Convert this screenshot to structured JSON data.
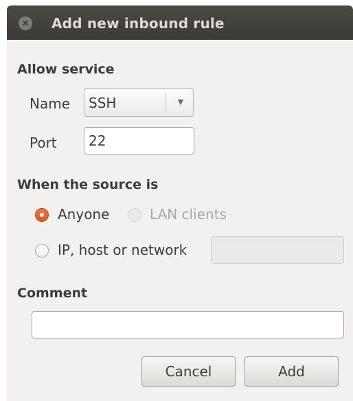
{
  "dialog": {
    "title": "Add new inbound rule",
    "close_icon": "×"
  },
  "allow_service": {
    "heading": "Allow service",
    "name_label": "Name",
    "name_value": "SSH",
    "dropdown_icon": "▼",
    "port_label": "Port",
    "port_value": "22"
  },
  "source": {
    "heading": "When the source is",
    "options": [
      {
        "label": "Anyone",
        "checked": true,
        "enabled": true
      },
      {
        "label": "LAN clients",
        "checked": false,
        "enabled": false
      },
      {
        "label": "IP, host or network",
        "checked": false,
        "enabled": true
      }
    ],
    "network_value": ""
  },
  "comment": {
    "heading": "Comment",
    "value": ""
  },
  "buttons": {
    "cancel": "Cancel",
    "add": "Add"
  },
  "colors": {
    "accent": "#e1561f",
    "titlebar": "#3c3b37",
    "dialog_bg": "#f2f1f0"
  }
}
